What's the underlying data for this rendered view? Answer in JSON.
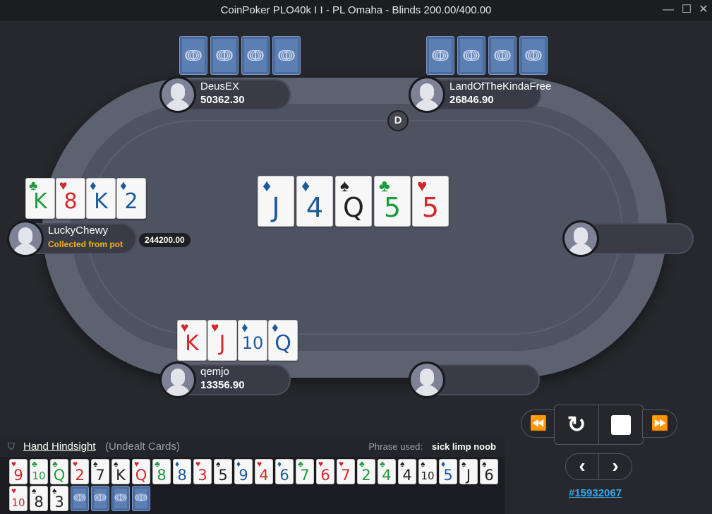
{
  "window": {
    "title": "CoinPoker PLO40k I I - PL Omaha - Blinds 200.00/400.00",
    "minimize_glyph": "—",
    "maximize_glyph": "☐",
    "close_glyph": "✕"
  },
  "dealer_button": "D",
  "players": {
    "deusex": {
      "name": "DeusEX",
      "stack": "50362.30"
    },
    "landofthekindafree": {
      "name": "LandOfTheKindaFree",
      "stack": "26846.90"
    },
    "luckychewy": {
      "name": "LuckyChewy",
      "status": "Collected from pot",
      "bet": "244200.00"
    },
    "qemjo": {
      "name": "qemjo",
      "stack": "13356.90"
    }
  },
  "hole_cards": {
    "luckychewy": [
      {
        "rank": "K",
        "suit": "♣",
        "color": "green"
      },
      {
        "rank": "8",
        "suit": "♥",
        "color": "red"
      },
      {
        "rank": "K",
        "suit": "♦",
        "color": "blue"
      },
      {
        "rank": "2",
        "suit": "♦",
        "color": "blue"
      }
    ],
    "qemjo": [
      {
        "rank": "K",
        "suit": "♥",
        "color": "red"
      },
      {
        "rank": "J",
        "suit": "♥",
        "color": "red"
      },
      {
        "rank": "10",
        "suit": "♦",
        "color": "blue"
      },
      {
        "rank": "Q",
        "suit": "♦",
        "color": "blue"
      }
    ]
  },
  "board": [
    {
      "rank": "J",
      "suit": "♦",
      "color": "blue"
    },
    {
      "rank": "4",
      "suit": "♦",
      "color": "blue"
    },
    {
      "rank": "Q",
      "suit": "♠",
      "color": "black"
    },
    {
      "rank": "5",
      "suit": "♣",
      "color": "green"
    },
    {
      "rank": "5",
      "suit": "♥",
      "color": "red"
    }
  ],
  "card_back_logo": "ↈ",
  "hindsight": {
    "title": "Hand Hindsight",
    "subtitle": "(Undealt Cards)",
    "phrase_label": "Phrase used:",
    "phrase_value": "sick limp noob",
    "cards": [
      {
        "rank": "9",
        "suit": "♥",
        "color": "red"
      },
      {
        "rank": "10",
        "suit": "♣",
        "color": "green"
      },
      {
        "rank": "Q",
        "suit": "♣",
        "color": "green"
      },
      {
        "rank": "2",
        "suit": "♥",
        "color": "red"
      },
      {
        "rank": "7",
        "suit": "♠",
        "color": "black"
      },
      {
        "rank": "K",
        "suit": "♠",
        "color": "black"
      },
      {
        "rank": "Q",
        "suit": "♥",
        "color": "red"
      },
      {
        "rank": "8",
        "suit": "♣",
        "color": "green"
      },
      {
        "rank": "8",
        "suit": "♦",
        "color": "blue"
      },
      {
        "rank": "3",
        "suit": "♥",
        "color": "red"
      },
      {
        "rank": "5",
        "suit": "♠",
        "color": "black"
      },
      {
        "rank": "9",
        "suit": "♦",
        "color": "blue"
      },
      {
        "rank": "4",
        "suit": "♥",
        "color": "red"
      },
      {
        "rank": "6",
        "suit": "♦",
        "color": "blue"
      },
      {
        "rank": "7",
        "suit": "♣",
        "color": "green"
      },
      {
        "rank": "6",
        "suit": "♥",
        "color": "red"
      },
      {
        "rank": "7",
        "suit": "♥",
        "color": "red"
      },
      {
        "rank": "2",
        "suit": "♣",
        "color": "green"
      },
      {
        "rank": "4",
        "suit": "♣",
        "color": "green"
      },
      {
        "rank": "4",
        "suit": "♠",
        "color": "black"
      },
      {
        "rank": "10",
        "suit": "♠",
        "color": "black"
      },
      {
        "rank": "5",
        "suit": "♦",
        "color": "blue"
      },
      {
        "rank": "J",
        "suit": "♠",
        "color": "black"
      },
      {
        "rank": "6",
        "suit": "♠",
        "color": "black"
      },
      {
        "rank": "10",
        "suit": "♥",
        "color": "red"
      },
      {
        "rank": "8",
        "suit": "♠",
        "color": "black"
      },
      {
        "rank": "3",
        "suit": "♠",
        "color": "black"
      }
    ],
    "facedown_count": 4
  },
  "controls": {
    "rewind_icon": "⏪",
    "replay_icon": "↻",
    "stop_icon": "■",
    "forward_icon": "⏩",
    "prev_icon": "‹",
    "next_icon": "›"
  },
  "hand_id": "#15932067",
  "colors": {
    "red": "#d5262c",
    "green": "#1e9a3c",
    "blue": "#1c5a9c",
    "black": "#222222",
    "status": "#f2b21f",
    "link": "#37a7e8"
  }
}
